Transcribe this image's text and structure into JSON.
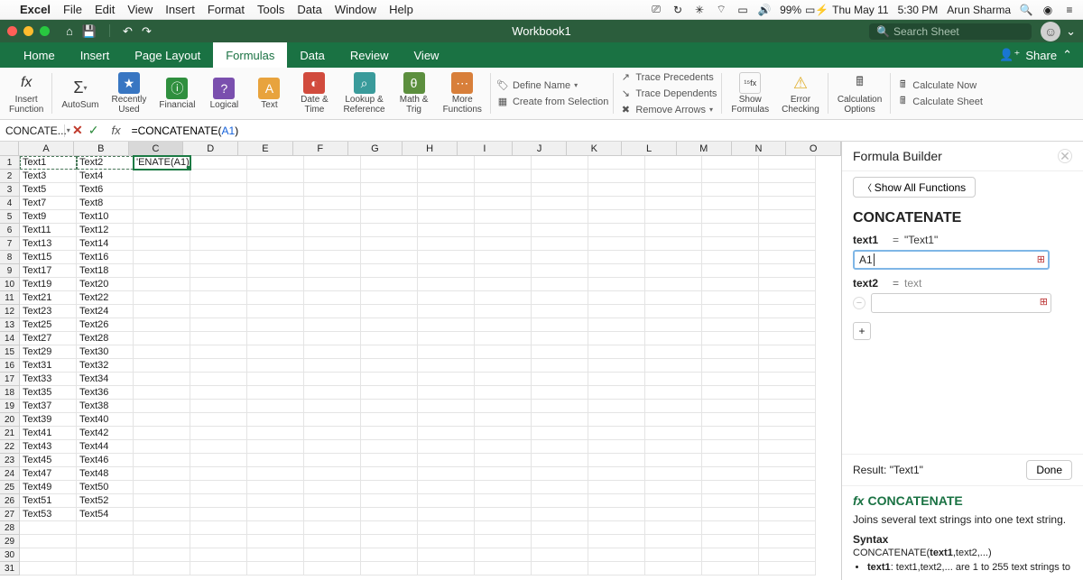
{
  "mac_menu": {
    "app": "Excel",
    "items": [
      "File",
      "Edit",
      "View",
      "Insert",
      "Format",
      "Tools",
      "Data",
      "Window",
      "Help"
    ],
    "battery": "99%",
    "date": "Thu May 11",
    "time": "5:30 PM",
    "user": "Arun Sharma"
  },
  "titlebar": {
    "title": "Workbook1",
    "search_placeholder": "Search Sheet"
  },
  "ribbon_tabs": [
    "Home",
    "Insert",
    "Page Layout",
    "Formulas",
    "Data",
    "Review",
    "View"
  ],
  "active_tab": "Formulas",
  "share_label": "Share",
  "ribbon": {
    "insert_function": "Insert\nFunction",
    "autosum": "AutoSum",
    "recent": "Recently\nUsed",
    "financial": "Financial",
    "logical": "Logical",
    "text": "Text",
    "datetime": "Date &\nTime",
    "lookup": "Lookup &\nReference",
    "math": "Math &\nTrig",
    "more": "More\nFunctions",
    "define_name": "Define Name",
    "create_sel": "Create from Selection",
    "trace_prec": "Trace Precedents",
    "trace_dep": "Trace Dependents",
    "remove_arrows": "Remove Arrows",
    "show_formulas": "Show\nFormulas",
    "error_check": "Error\nChecking",
    "calc_options": "Calculation\nOptions",
    "calc_now": "Calculate Now",
    "calc_sheet": "Calculate Sheet"
  },
  "namebox": "CONCATE...",
  "formula_text_fn": "=CONCATENATE(",
  "formula_text_arg": "A1",
  "formula_text_end": ")",
  "columns": [
    "A",
    "B",
    "C",
    "D",
    "E",
    "F",
    "G",
    "H",
    "I",
    "J",
    "K",
    "L",
    "M",
    "N",
    "O"
  ],
  "selected_col": "C",
  "rows": [
    {
      "n": 1,
      "A": "Text1",
      "B": "Text2",
      "C": "'ENATE(A1)"
    },
    {
      "n": 2,
      "A": "Text3",
      "B": "Text4",
      "C": ""
    },
    {
      "n": 3,
      "A": "Text5",
      "B": "Text6",
      "C": ""
    },
    {
      "n": 4,
      "A": "Text7",
      "B": "Text8",
      "C": ""
    },
    {
      "n": 5,
      "A": "Text9",
      "B": "Text10",
      "C": ""
    },
    {
      "n": 6,
      "A": "Text11",
      "B": "Text12",
      "C": ""
    },
    {
      "n": 7,
      "A": "Text13",
      "B": "Text14",
      "C": ""
    },
    {
      "n": 8,
      "A": "Text15",
      "B": "Text16",
      "C": ""
    },
    {
      "n": 9,
      "A": "Text17",
      "B": "Text18",
      "C": ""
    },
    {
      "n": 10,
      "A": "Text19",
      "B": "Text20",
      "C": ""
    },
    {
      "n": 11,
      "A": "Text21",
      "B": "Text22",
      "C": ""
    },
    {
      "n": 12,
      "A": "Text23",
      "B": "Text24",
      "C": ""
    },
    {
      "n": 13,
      "A": "Text25",
      "B": "Text26",
      "C": ""
    },
    {
      "n": 14,
      "A": "Text27",
      "B": "Text28",
      "C": ""
    },
    {
      "n": 15,
      "A": "Text29",
      "B": "Text30",
      "C": ""
    },
    {
      "n": 16,
      "A": "Text31",
      "B": "Text32",
      "C": ""
    },
    {
      "n": 17,
      "A": "Text33",
      "B": "Text34",
      "C": ""
    },
    {
      "n": 18,
      "A": "Text35",
      "B": "Text36",
      "C": ""
    },
    {
      "n": 19,
      "A": "Text37",
      "B": "Text38",
      "C": ""
    },
    {
      "n": 20,
      "A": "Text39",
      "B": "Text40",
      "C": ""
    },
    {
      "n": 21,
      "A": "Text41",
      "B": "Text42",
      "C": ""
    },
    {
      "n": 22,
      "A": "Text43",
      "B": "Text44",
      "C": ""
    },
    {
      "n": 23,
      "A": "Text45",
      "B": "Text46",
      "C": ""
    },
    {
      "n": 24,
      "A": "Text47",
      "B": "Text48",
      "C": ""
    },
    {
      "n": 25,
      "A": "Text49",
      "B": "Text50",
      "C": ""
    },
    {
      "n": 26,
      "A": "Text51",
      "B": "Text52",
      "C": ""
    },
    {
      "n": 27,
      "A": "Text53",
      "B": "Text54",
      "C": ""
    },
    {
      "n": 28,
      "A": "",
      "B": "",
      "C": ""
    },
    {
      "n": 29,
      "A": "",
      "B": "",
      "C": ""
    },
    {
      "n": 30,
      "A": "",
      "B": "",
      "C": ""
    },
    {
      "n": 31,
      "A": "",
      "B": "",
      "C": ""
    }
  ],
  "active_cell": {
    "row": 1,
    "col": "C"
  },
  "marquee_cells": [
    {
      "row": 1,
      "col": "A"
    },
    {
      "row": 1,
      "col": "B"
    }
  ],
  "panel": {
    "title": "Formula Builder",
    "show_all": "Show All Functions",
    "fn_name": "CONCATENATE",
    "args": [
      {
        "label": "text1",
        "value": "A1",
        "evaluated": "\"Text1\""
      },
      {
        "label": "text2",
        "value": "",
        "evaluated": "text"
      }
    ],
    "result_label": "Result:",
    "result_value": "\"Text1\"",
    "done": "Done",
    "help_fn": "CONCATENATE",
    "help_desc": "Joins several text strings into one text string.",
    "syntax_hd": "Syntax",
    "syntax": "CONCATENATE(text1,text2,...)",
    "syntax_item": "text1: text1,text2,... are 1 to 255 text strings to"
  }
}
